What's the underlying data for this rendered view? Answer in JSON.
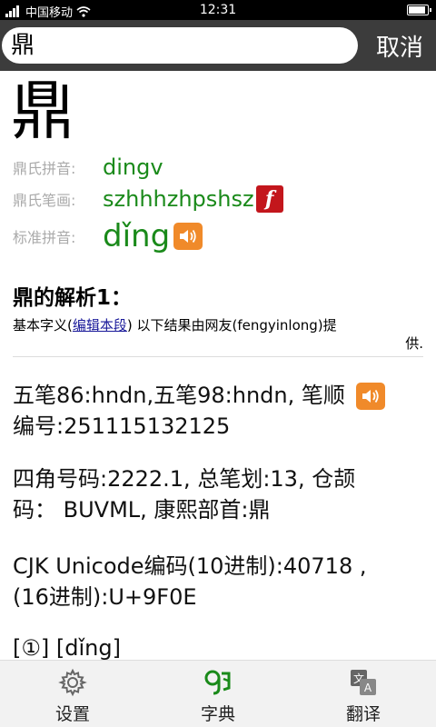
{
  "status_bar": {
    "carrier": "中国移动",
    "time": "12:31"
  },
  "search": {
    "value": "鼎",
    "cancel_label": "取消"
  },
  "entry": {
    "character": "鼎",
    "rows": [
      {
        "label": "鼎氏拼音:",
        "value": "dingv"
      },
      {
        "label": "鼎氏笔画:",
        "value": "szhhhzhpshsz"
      },
      {
        "label": "标准拼音:",
        "value": "dǐng"
      }
    ],
    "flash_glyph": "f"
  },
  "analysis": {
    "title": "鼎的解析1：",
    "prefix": "基本字义(",
    "edit_link": "编辑本段",
    "suffix_a": ")  以下结果由网友(fengyinlong)提",
    "suffix_b": "供."
  },
  "paragraphs": {
    "wubi": "五笔86:hndn,五笔98:hndn, 笔顺编号:251115132125",
    "wubi_a": "五笔86:hndn,五笔98:hndn, 笔顺",
    "wubi_b": "编号:251115132125",
    "sijiao_a": "四角号码:2222.1, 总笔划:13, 仓颉",
    "sijiao_b": "码：  BUVML, 康熙部首:鼎",
    "cjk_a": "CJK Unicode编码(10进制):40718 ,",
    "cjk_b": "(16进制):U+9F0E",
    "sense": "[①]  [dǐng]"
  },
  "bottom_nav": [
    {
      "label": "设置",
      "icon": "gear-icon"
    },
    {
      "label": "字典",
      "icon": "dictionary-icon"
    },
    {
      "label": "翻译",
      "icon": "translate-icon"
    }
  ],
  "colors": {
    "accent_green": "#1a8a1a",
    "speaker_orange": "#f08a2a",
    "flash_red": "#c3161c"
  }
}
